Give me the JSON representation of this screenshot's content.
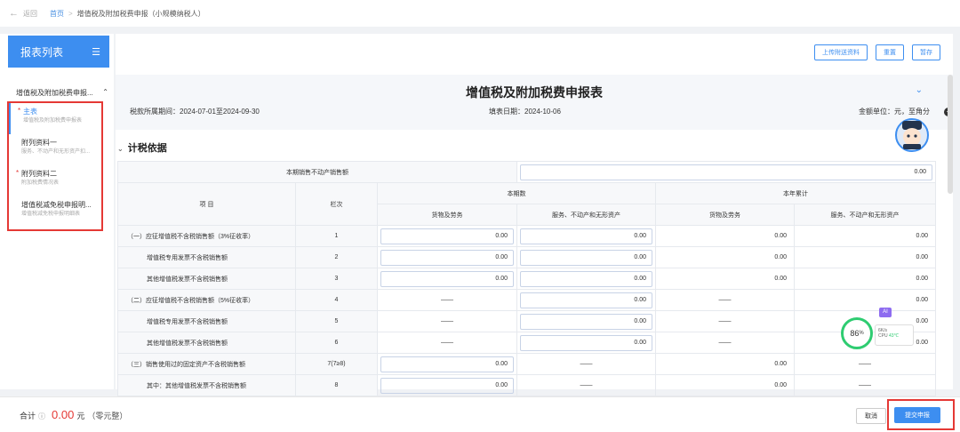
{
  "nav": {
    "back_label": "返回",
    "crumbs": [
      "首页",
      "增值税及附加税费申报（小规模纳税人）"
    ]
  },
  "sidebar": {
    "title": "报表列表",
    "group": "增值税及附加税费申报...",
    "items": [
      {
        "name": "主表",
        "sub": "增值税及附加税费申报表",
        "required": true,
        "active": true
      },
      {
        "name": "附列资料一",
        "sub": "服务、不动产和无形资产扣...",
        "required": false,
        "active": false
      },
      {
        "name": "附列资料二",
        "sub": "附加税费情况表",
        "required": true,
        "active": false
      },
      {
        "name": "增值税减免税申报明...",
        "sub": "增值税减免税申报明细表",
        "required": false,
        "active": false
      }
    ]
  },
  "toolbar": {
    "upload_label": "上传附送资料",
    "reset_label": "重置",
    "save_label": "暂存"
  },
  "form": {
    "title": "增值税及附加税费申报表",
    "period": "税款所属期间：2024-07-01至2024-09-30",
    "fill_date": "填表日期：2024-10-06",
    "unit": "金额单位：元，至角分",
    "section": "计税依据"
  },
  "table": {
    "top_row_label": "本期销售不动产销售额",
    "top_row_value": "0.00",
    "col_item": "项 目",
    "col_no": "栏次",
    "col_current": "本期数",
    "col_ytd": "本年累计",
    "col_goods": "货物及劳务",
    "col_services": "服务、不动产和无形资产",
    "dash": "——",
    "rows": [
      {
        "label": "（一）应征增值税不含税销售额（3%征收率）",
        "no": "1",
        "c1": "0.00",
        "c2": "0.00",
        "c3": "0.00",
        "c4": "0.00"
      },
      {
        "label": "增值税专用发票不含税销售额",
        "no": "2",
        "c1": "0.00",
        "c2": "0.00",
        "c3": "0.00",
        "c4": "0.00"
      },
      {
        "label": "其他增值税发票不含税销售额",
        "no": "3",
        "c1": "0.00",
        "c2": "0.00",
        "c3": "0.00",
        "c4": "0.00"
      },
      {
        "label": "（二）应征增值税不含税销售额（5%征收率）",
        "no": "4",
        "c2": "0.00",
        "c4": "0.00"
      },
      {
        "label": "增值税专用发票不含税销售额",
        "no": "5",
        "c2": "0.00",
        "c4": "0.00"
      },
      {
        "label": "其他增值税发票不含税销售额",
        "no": "6",
        "c2": "0.00",
        "c4": "0.00"
      },
      {
        "label": "（三）销售使用过的固定资产不含税销售额",
        "no": "7(7≥8)",
        "c1": "0.00",
        "c3": "0.00"
      },
      {
        "label": "其中：其他增值税发票不含税销售额",
        "no": "8",
        "c1": "0.00",
        "c3": "0.00"
      }
    ]
  },
  "widget": {
    "ai": "AI",
    "cpu_percent": "86",
    "cpu_unit": "%",
    "cpu_label": "CPU",
    "cpu_temp": "43℃",
    "mem": "6K/s"
  },
  "footer": {
    "total_label": "合计",
    "total_amount": "0.00",
    "currency": "元",
    "total_note": "（零元整）",
    "cancel_label": "取消",
    "submit_label": "提交申报"
  }
}
